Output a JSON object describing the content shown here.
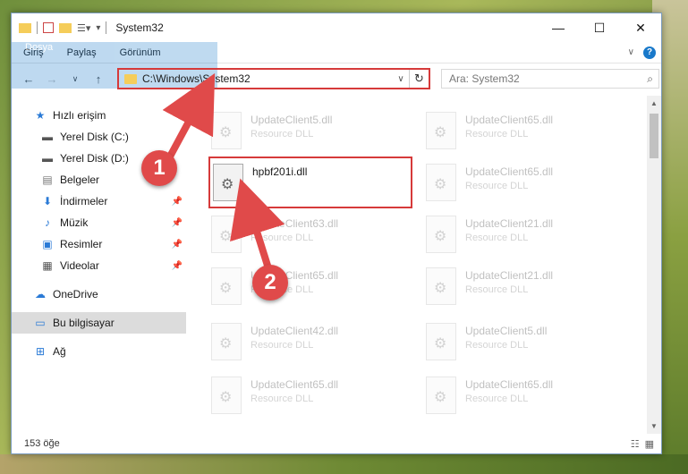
{
  "window": {
    "title": "System32"
  },
  "ribbon": {
    "tabs": [
      "Dosya",
      "Giriş",
      "Paylaş",
      "Görünüm"
    ]
  },
  "address": {
    "path": "C:\\Windows\\System32"
  },
  "search": {
    "placeholder": "Ara: System32"
  },
  "sidebar": {
    "items": [
      {
        "label": "Hızlı erişim",
        "icon": "star-icon"
      },
      {
        "label": "Yerel Disk (C:)",
        "icon": "drive-icon"
      },
      {
        "label": "Yerel Disk (D:)",
        "icon": "drive-icon"
      },
      {
        "label": "Belgeler",
        "icon": "documents-icon"
      },
      {
        "label": "İndirmeler",
        "icon": "download-icon"
      },
      {
        "label": "Müzik",
        "icon": "music-icon"
      },
      {
        "label": "Resimler",
        "icon": "pictures-icon"
      },
      {
        "label": "Videolar",
        "icon": "video-icon"
      },
      {
        "label": "OneDrive",
        "icon": "cloud-icon"
      },
      {
        "label": "Bu bilgisayar",
        "icon": "computer-icon"
      },
      {
        "label": "Ağ",
        "icon": "network-icon"
      }
    ]
  },
  "files": [
    {
      "name": "UpdateClient5.dll",
      "type": "Resource DLL"
    },
    {
      "name": "UpdateClient65.dll",
      "type": "Resource DLL"
    },
    {
      "name": "hpbf201i.dll",
      "type": ""
    },
    {
      "name": "UpdateClient65.dll",
      "type": "Resource DLL"
    },
    {
      "name": "UpdateClient63.dll",
      "type": "Resource DLL"
    },
    {
      "name": "UpdateClient21.dll",
      "type": "Resource DLL"
    },
    {
      "name": "UpdateClient65.dll",
      "type": "Resource DLL"
    },
    {
      "name": "UpdateClient21.dll",
      "type": "Resource DLL"
    },
    {
      "name": "UpdateClient42.dll",
      "type": "Resource DLL"
    },
    {
      "name": "UpdateClient5.dll",
      "type": "Resource DLL"
    },
    {
      "name": "UpdateClient65.dll",
      "type": "Resource DLL"
    },
    {
      "name": "UpdateClient65.dll",
      "type": "Resource DLL"
    }
  ],
  "status": {
    "count": "153 öğe"
  },
  "callouts": {
    "one": "1",
    "two": "2"
  },
  "colors": {
    "accent": "#1979ca",
    "highlight": "#d63a3a",
    "callout": "#e04a4a"
  }
}
